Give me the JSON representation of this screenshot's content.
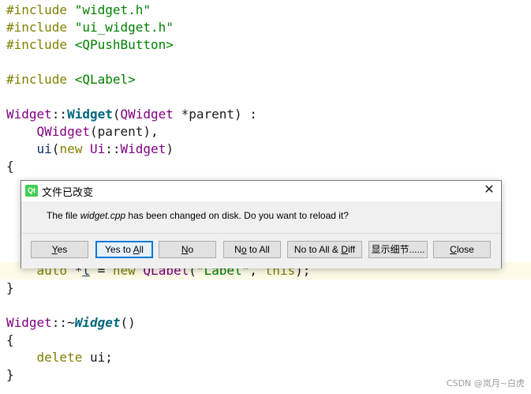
{
  "editor": {
    "lines": {
      "l1": {
        "kw": "#include",
        "str": "\"widget.h\""
      },
      "l2": {
        "kw": "#include",
        "str": "\"ui_widget.h\""
      },
      "l3": {
        "kw": "#include",
        "str": "<QPushButton>"
      },
      "l5": {
        "kw": "#include",
        "str": "<QLabel>"
      },
      "l7": {
        "cls": "Widget",
        "sep": "::",
        "fn": "Widget",
        "open": "(",
        "type": "QWidget",
        "rest": " *parent) :"
      },
      "l8": {
        "type": "QWidget",
        "rest": "(parent),"
      },
      "l9": {
        "var": "ui",
        "open": "(",
        "kw": "new",
        "ns": "Ui",
        "sep": "::",
        "type": "Widget",
        "close": ")"
      },
      "l10": {
        "text": "{"
      },
      "l15": {
        "kw1": "auto",
        "rest1": " *",
        "var": "l",
        "rest2": " = ",
        "kw2": "new",
        "type": "QLabel",
        "open": "(",
        "str": "\"Label\"",
        "comma": ", ",
        "kw3": "this",
        "close": ");"
      },
      "l16": {
        "text": "}"
      },
      "l18": {
        "cls": "Widget",
        "sep": "::~",
        "fn": "Widget",
        "rest": "()"
      },
      "l19": {
        "text": "{"
      },
      "l20": {
        "kw": "delete",
        "rest": " ui;"
      },
      "l21": {
        "text": "}"
      }
    }
  },
  "dialog": {
    "title": "文件已改变",
    "logo_text": "Qt",
    "close_glyph": "✕",
    "message_prefix": "The file ",
    "message_file": "widget.cpp",
    "message_suffix": " has been changed on disk. Do you want to reload it?",
    "buttons": {
      "yes": {
        "mn": "Y",
        "rest": "es"
      },
      "yes_all": {
        "pre": "Yes to ",
        "mn": "A",
        "rest": "ll"
      },
      "no": {
        "mn": "N",
        "rest": "o"
      },
      "no_all": {
        "pre": "N",
        "mn": "o",
        "rest": " to All"
      },
      "no_all_diff": {
        "pre": "No to All & ",
        "mn": "D",
        "rest": "iff"
      },
      "details": "显示细节......",
      "close": {
        "mn": "C",
        "rest": "lose"
      }
    }
  },
  "watermark": "CSDN @岚月~白虎"
}
